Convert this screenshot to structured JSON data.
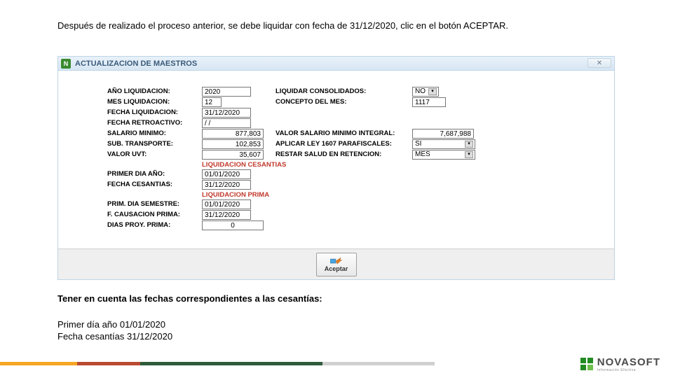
{
  "instructions": {
    "top": "Después de realizado el proceso anterior, se debe liquidar con  fecha de 31/12/2020, clic en el botón ACEPTAR.",
    "mid": "Tener en cuenta las fechas correspondientes a las cesantías:",
    "bot1": "Primer día año 01/01/2020",
    "bot2": "Fecha cesantías 31/12/2020"
  },
  "window": {
    "title": "ACTUALIZACION DE MAESTROS"
  },
  "left_labels": {
    "ano": "AÑO LIQUIDACION:",
    "mes": "MES LIQUIDACION:",
    "fecha_liq": "FECHA LIQUIDACION:",
    "fecha_retro": "FECHA RETROACTIVO:",
    "sal_min": "SALARIO MINIMO:",
    "sub_trans": "SUB. TRANSPORTE:",
    "valor_uvt": "VALOR UVT:",
    "primer_dia_ano": "PRIMER DIA AÑO:",
    "fecha_ces": "FECHA CESANTIAS:",
    "prim_dia_sem": "PRIM. DIA SEMESTRE:",
    "f_caus_prima": "F. CAUSACION PRIMA:",
    "dias_proy": "DIAS PROY. PRIMA:"
  },
  "left_values": {
    "ano": "2020",
    "mes": "12",
    "fecha_liq": "31/12/2020",
    "fecha_retro": "  /  /",
    "sal_min": "877,803",
    "sub_trans": "102,853",
    "valor_uvt": "35,607",
    "primer_dia_ano": "01/01/2020",
    "fecha_ces": "31/12/2020",
    "prim_dia_sem": "01/01/2020",
    "f_caus_prima": "31/12/2020",
    "dias_proy": "0"
  },
  "right_labels": {
    "liq_cons": "LIQUIDAR CONSOLIDADOS:",
    "concepto": "CONCEPTO DEL MES:",
    "val_sal_int": "VALOR SALARIO MINIMO INTEGRAL:",
    "aplicar_ley": "APLICAR LEY 1607 PARAFISCALES:",
    "restar_salud": "RESTAR SALUD EN RETENCION:"
  },
  "right_values": {
    "liq_cons": "NO",
    "concepto": "1117",
    "val_sal_int": "7,687,988",
    "aplicar_ley": "SI",
    "restar_salud": "MES"
  },
  "sections": {
    "cesantias": "LIQUIDACION CESANTIAS",
    "prima": "LIQUIDACION PRIMA"
  },
  "buttons": {
    "aceptar": "Aceptar"
  },
  "logo": {
    "name": "NOVASOFT",
    "tagline": "Información   Efectiva"
  }
}
